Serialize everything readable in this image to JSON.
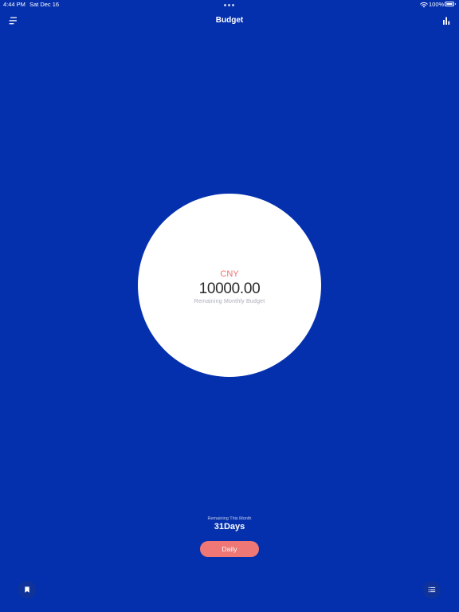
{
  "status_bar": {
    "time": "4:44 PM",
    "date": "Sat Dec 16",
    "battery": "100%"
  },
  "nav": {
    "title": "Budget",
    "menu_icon": "menu-icon",
    "stats_icon": "bar-chart-icon"
  },
  "budget": {
    "currency": "CNY",
    "amount": "10000.00",
    "caption": "Remaining Monthly Budget"
  },
  "period": {
    "caption": "Remaining This Month",
    "days": "31Days"
  },
  "actions": {
    "daily_label": "Daily",
    "bookmark_icon": "bookmark-icon",
    "list_icon": "list-icon"
  },
  "colors": {
    "background": "#0530ad",
    "accent": "#ef7775",
    "currency": "#ef6f6c",
    "amount": "#2b2b2b"
  }
}
